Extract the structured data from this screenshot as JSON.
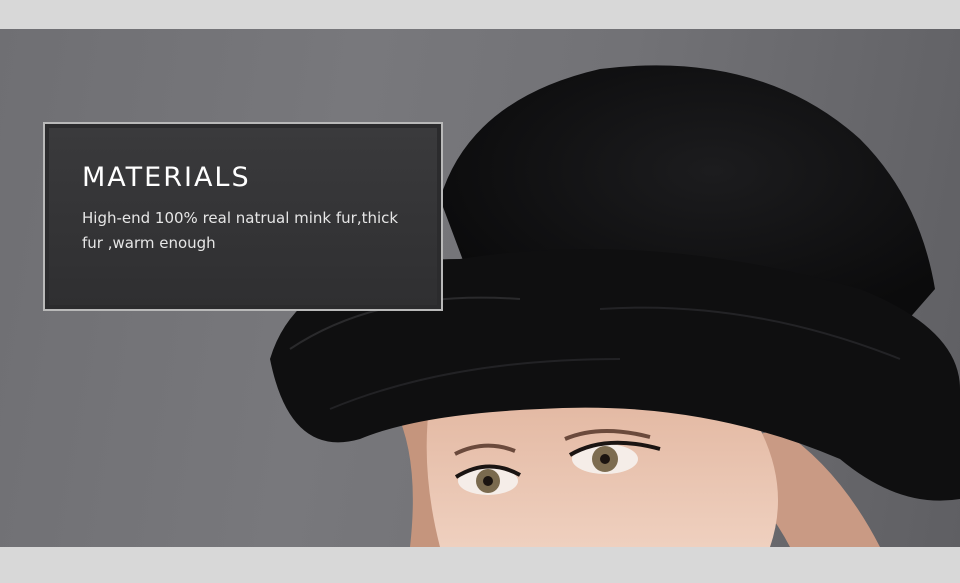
{
  "banner": {
    "title": "MATERIALS",
    "description": "High-end 100% real natrual mink fur,thick fur ,warm enough"
  },
  "photo": {
    "subject": "woman-wearing-black-mink-fur-hat",
    "background_color": "#727276",
    "hat_color": "#121214",
    "skin_color": "#e8c2ad",
    "hair_color": "#c99a84"
  }
}
